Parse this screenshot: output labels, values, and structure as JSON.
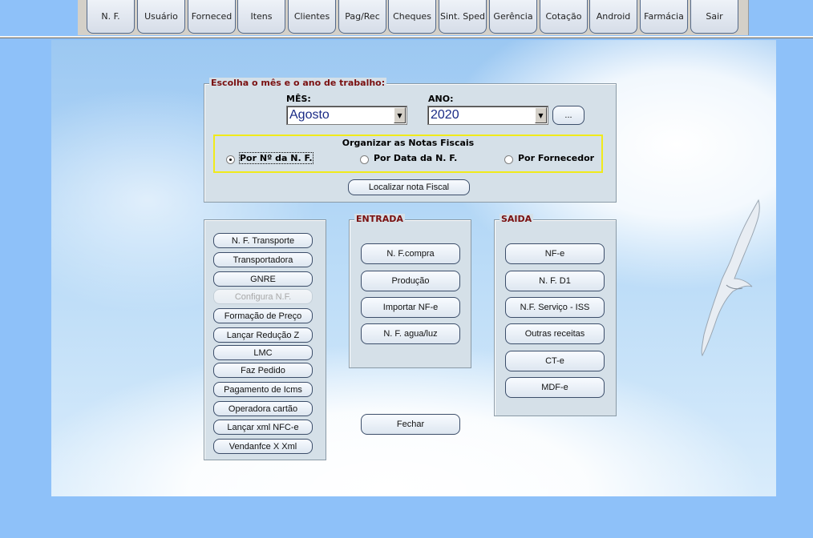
{
  "toolbar": {
    "items": [
      "N. F.",
      "Usuário",
      "Forneced",
      "Itens",
      "Clientes",
      "Pag/Rec",
      "Cheques",
      "Sint. Sped",
      "Gerência",
      "Cotação",
      "Android",
      "Farmácia",
      "Sair"
    ]
  },
  "period": {
    "legend": "Escolha o mês e o ano de trabalho:",
    "month_label": "MÊS:",
    "month_value": "Agosto",
    "year_label": "ANO:",
    "year_value": "2020",
    "more_button": "...",
    "organize_title": "Organizar as Notas Fiscais",
    "options": [
      {
        "label": "Por Nº da N. F.",
        "selected": true
      },
      {
        "label": "Por Data da N. F.",
        "selected": false
      },
      {
        "label": "Por Fornecedor",
        "selected": false
      }
    ],
    "locate_button": "Localizar nota Fiscal"
  },
  "left_panel": {
    "buttons": [
      "N. F. Transporte",
      "Transportadora",
      "GNRE",
      "Configura N.F.",
      "Formação de Preço",
      "Lançar Redução Z",
      "LMC",
      "Faz Pedido",
      "Pagamento de Icms",
      "Operadora cartão",
      "Lançar xml NFC-e",
      "Vendanfce X Xml"
    ],
    "disabled": [
      "Configura N.F."
    ]
  },
  "entrada": {
    "legend": "ENTRADA",
    "buttons": [
      "N. F.compra",
      "Produção",
      "Importar NF-e",
      "N. F. agua/luz"
    ]
  },
  "saida": {
    "legend": "SAIDA",
    "buttons": [
      "NF-e",
      "N. F. D1",
      "N.F. Serviço - ISS",
      "Outras receitas",
      "CT-e",
      "MDF-e"
    ]
  },
  "close_button": "Fechar",
  "icons": {
    "dropdown": "chevron-down-icon",
    "seagull": "seagull-image"
  }
}
